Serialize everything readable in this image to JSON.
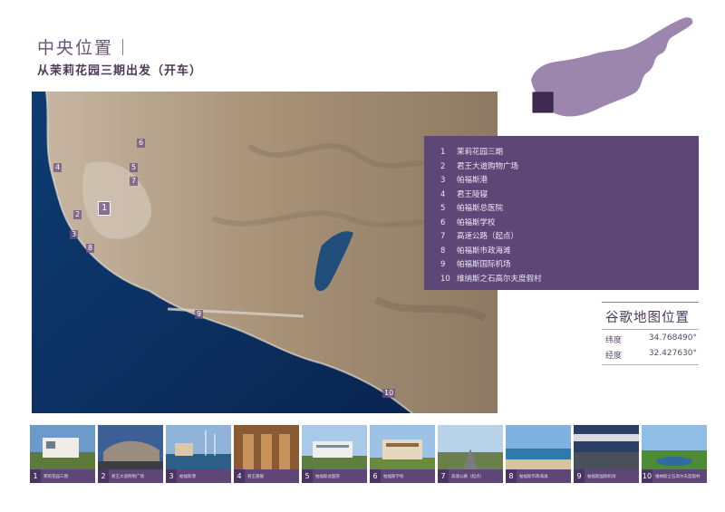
{
  "header": {
    "title": "中央位置",
    "subtitle": "从茉莉花园三期出发（开车）"
  },
  "legend": {
    "items": [
      {
        "num": "1",
        "label": "茉莉花园三期"
      },
      {
        "num": "2",
        "label": "君王大道购物广场"
      },
      {
        "num": "3",
        "label": "帕福斯港"
      },
      {
        "num": "4",
        "label": "君王陵寝"
      },
      {
        "num": "5",
        "label": "帕福斯总医院"
      },
      {
        "num": "6",
        "label": "帕福斯学校"
      },
      {
        "num": "7",
        "label": "高速公路（起点）"
      },
      {
        "num": "8",
        "label": "帕福斯市政海滩"
      },
      {
        "num": "9",
        "label": "帕福斯国际机场"
      },
      {
        "num": "10",
        "label": "维纳斯之石高尔夫度假村"
      }
    ]
  },
  "map_markers": [
    "1",
    "2",
    "3",
    "4",
    "5",
    "6",
    "7",
    "8",
    "9",
    "10"
  ],
  "coordinates": {
    "title": "谷歌地图位置",
    "lat_label": "纬度",
    "lat_value": "34.768490°",
    "lon_label": "经度",
    "lon_value": "32.427630°"
  },
  "thumbnails": [
    {
      "num": "1",
      "caption": "茉莉花园三期"
    },
    {
      "num": "2",
      "caption": "君王大道购物广场"
    },
    {
      "num": "3",
      "caption": "帕福斯港"
    },
    {
      "num": "4",
      "caption": "君王陵寝"
    },
    {
      "num": "5",
      "caption": "帕福斯总医院"
    },
    {
      "num": "6",
      "caption": "帕福斯学校"
    },
    {
      "num": "7",
      "caption": "高速公路（起点）"
    },
    {
      "num": "8",
      "caption": "帕福斯市政海滩"
    },
    {
      "num": "9",
      "caption": "帕福斯国际机场"
    },
    {
      "num": "10",
      "caption": "维纳斯之石高尔夫度假村"
    }
  ],
  "colors": {
    "accent": "#5e4677",
    "sea": "#123a6b",
    "land": "#b9a58f"
  }
}
